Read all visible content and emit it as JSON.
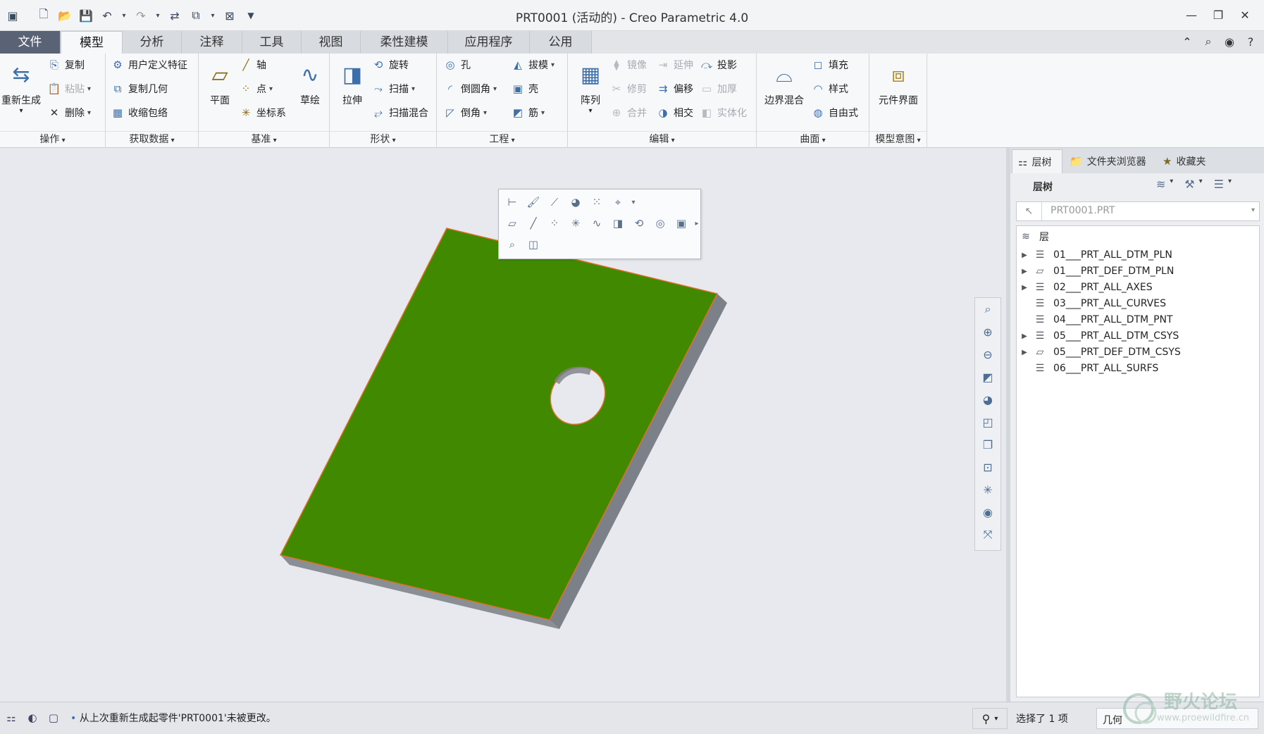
{
  "window": {
    "title": "PRT0001 (活动的) - Creo Parametric 4.0",
    "controls": [
      "—",
      "❐",
      "✕"
    ]
  },
  "ribbon_tabs": [
    "文件",
    "模型",
    "分析",
    "注释",
    "工具",
    "视图",
    "柔性建模",
    "应用程序",
    "公用"
  ],
  "ribbon": {
    "ops": {
      "label": "操作",
      "regen": "重新生成",
      "copy": "复制",
      "paste": "粘贴",
      "delete": "删除"
    },
    "getdata": {
      "label": "获取数据",
      "udf": "用户定义特征",
      "copy_geom": "复制几何",
      "shrinkwrap": "收缩包络"
    },
    "datum": {
      "label": "基准",
      "plane": "平面",
      "axis": "轴",
      "point": "点",
      "csys": "坐标系",
      "sketch": "草绘"
    },
    "shapes": {
      "label": "形状",
      "extrude": "拉伸",
      "revolve": "旋转",
      "sweep": "扫描",
      "swept_blend": "扫描混合"
    },
    "engineering": {
      "label": "工程",
      "hole": "孔",
      "round": "倒圆角",
      "chamfer": "倒角",
      "draft": "拔模",
      "shell": "壳",
      "rib": "筋"
    },
    "editing": {
      "label": "编辑",
      "pattern": "阵列",
      "mirror": "镜像",
      "extend": "延伸",
      "project": "投影",
      "trim": "修剪",
      "offset": "偏移",
      "thicken": "加厚",
      "merge": "合并",
      "intersect": "相交",
      "solidify": "实体化"
    },
    "surfaces": {
      "label": "曲面",
      "boundary_blend": "边界混合",
      "fill": "填充",
      "style": "样式",
      "freestyle": "自由式"
    },
    "intent": {
      "label": "模型意图",
      "component_interface": "元件界面"
    }
  },
  "nav_tabs": [
    "层树",
    "文件夹浏览器",
    "收藏夹"
  ],
  "layer_tree": {
    "title": "层树",
    "active_model": "PRT0001.PRT",
    "root": "层",
    "items": [
      {
        "name": "01___PRT_ALL_DTM_PLN",
        "expandable": true
      },
      {
        "name": "01___PRT_DEF_DTM_PLN",
        "expandable": true
      },
      {
        "name": "02___PRT_ALL_AXES",
        "expandable": true
      },
      {
        "name": "03___PRT_ALL_CURVES",
        "expandable": false
      },
      {
        "name": "04___PRT_ALL_DTM_PNT",
        "expandable": false
      },
      {
        "name": "05___PRT_ALL_DTM_CSYS",
        "expandable": true
      },
      {
        "name": "05___PRT_DEF_DTM_CSYS",
        "expandable": true
      },
      {
        "name": "06___PRT_ALL_SURFS",
        "expandable": false
      }
    ]
  },
  "status": {
    "message": "从上次重新生成起零件'PRT0001'未被更改。",
    "selection": "选择了 1 项",
    "filter": "几何"
  },
  "watermark": {
    "title": "野火论坛",
    "url": "www.proewildfire.cn"
  },
  "colors": {
    "part_face": "#418a00",
    "part_side": "#7c8088",
    "edge": "#e0702a",
    "background": "#e7e9ee"
  }
}
